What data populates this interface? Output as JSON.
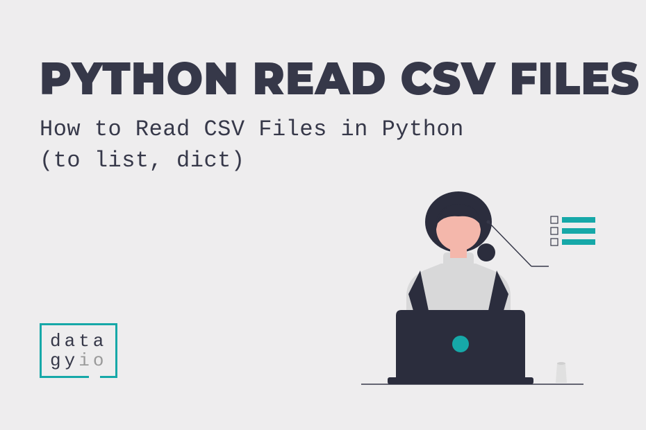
{
  "title": "PYTHON READ CSV FILES",
  "subtitle": "How to Read CSV Files in Python\n(to list, dict)",
  "logo": {
    "line1": "data",
    "line2": "gy",
    "line2_suffix": "io"
  },
  "colors": {
    "background": "#eeedee",
    "primary": "#363849",
    "accent": "#16a8a8",
    "muted": "#9a9a9a",
    "skin": "#f4b7ab",
    "laptop": "#2b2d3d",
    "shirt": "#d8d8d9"
  }
}
